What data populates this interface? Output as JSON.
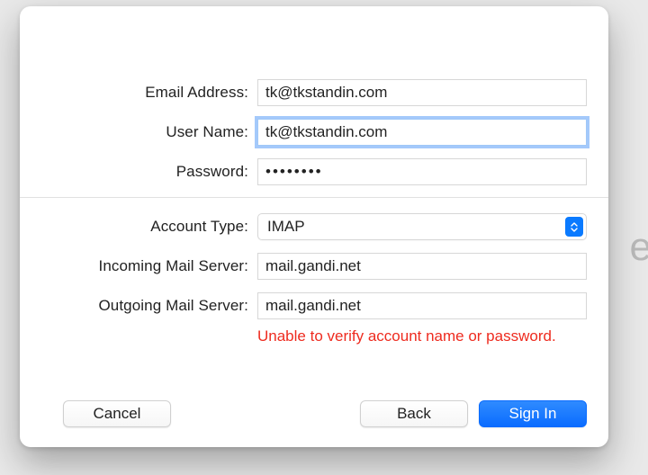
{
  "fields": {
    "email": {
      "label": "Email Address:",
      "value": "tk@tkstandin.com"
    },
    "username": {
      "label": "User Name:",
      "value": "tk@tkstandin.com"
    },
    "password": {
      "label": "Password:",
      "value": "••••••••"
    },
    "account_type": {
      "label": "Account Type:",
      "selected": "IMAP"
    },
    "incoming": {
      "label": "Incoming Mail Server:",
      "value": "mail.gandi.net"
    },
    "outgoing": {
      "label": "Outgoing Mail Server:",
      "value": "mail.gandi.net"
    }
  },
  "error_message": "Unable to verify account name or password.",
  "buttons": {
    "cancel": "Cancel",
    "back": "Back",
    "signin": "Sign In"
  }
}
